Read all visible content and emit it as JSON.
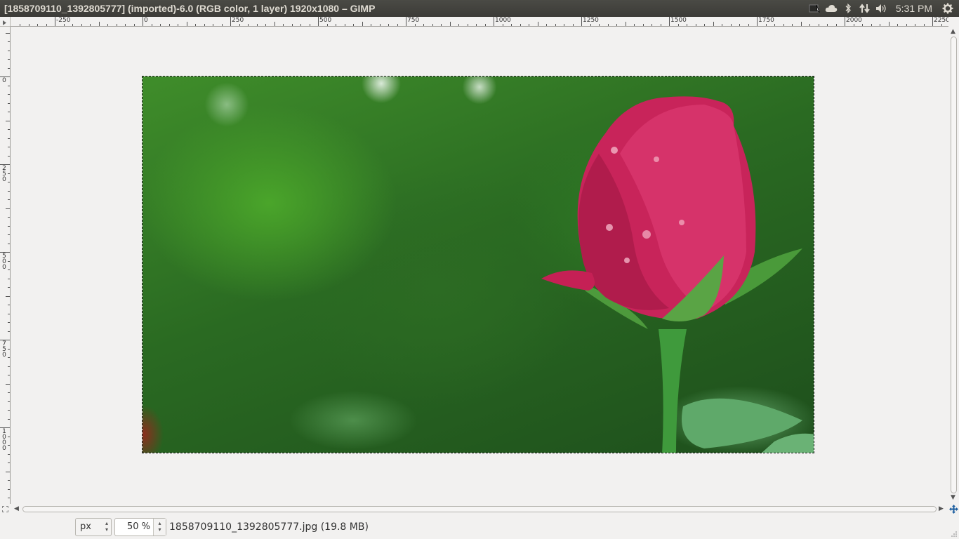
{
  "window": {
    "title": "[1858709110_1392805777] (imported)-6.0 (RGB color, 1 layer) 1920x1080 – GIMP"
  },
  "tray": {
    "clock": "5:31 PM",
    "icons": [
      "keyboard-indicator-icon",
      "cloud-icon",
      "bluetooth-icon",
      "network-icon",
      "volume-icon",
      "gear-icon"
    ]
  },
  "ruler": {
    "h_labels": [
      "-250",
      "0",
      "250",
      "500",
      "750",
      "1000",
      "1250",
      "1500",
      "1750",
      "2000",
      "2250"
    ],
    "v_labels": [
      "0",
      "250",
      "500",
      "750",
      "1000"
    ]
  },
  "statusbar": {
    "unit": "px",
    "zoom": "50 %",
    "info": "1858709110_1392805777.jpg (19.8 MB)"
  },
  "colors": {
    "panel": "#3c3b37",
    "panel_text": "#dfdbd2",
    "background": "#f2f1f0"
  }
}
